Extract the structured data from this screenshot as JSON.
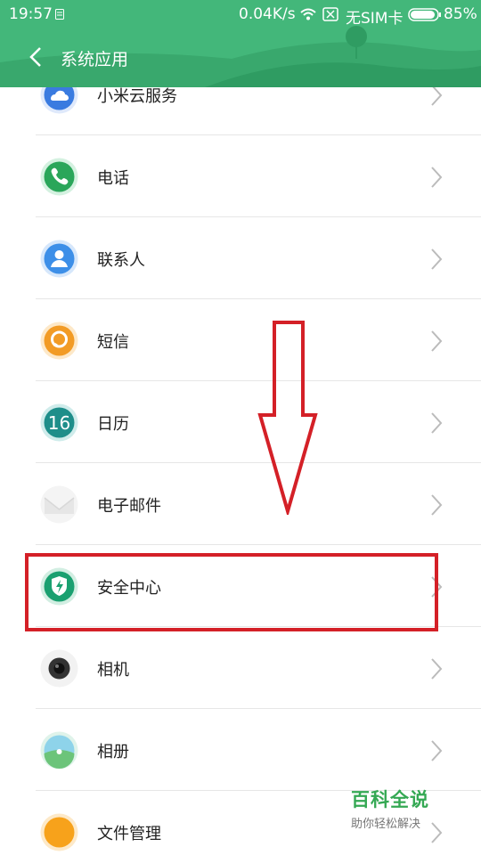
{
  "status_bar": {
    "time": "19:57",
    "speed": "0.04K/s",
    "sim": "无SIM卡",
    "battery": "85%"
  },
  "header": {
    "title": "系统应用"
  },
  "apps": [
    {
      "name": "小米云服务",
      "icon": "cloud-icon",
      "color": "#3a7be0"
    },
    {
      "name": "电话",
      "icon": "phone-icon",
      "color": "#2aa65a"
    },
    {
      "name": "联系人",
      "icon": "contacts-icon",
      "color": "#3d8fe8"
    },
    {
      "name": "短信",
      "icon": "message-icon",
      "color": "#f29b25"
    },
    {
      "name": "日历",
      "icon": "calendar-icon",
      "color": "#1e8e8a",
      "icon_text": "16"
    },
    {
      "name": "电子邮件",
      "icon": "mail-icon",
      "color": "#e8e8e8"
    },
    {
      "name": "安全中心",
      "icon": "security-shield-icon",
      "color": "#1aa070"
    },
    {
      "name": "相机",
      "icon": "camera-icon",
      "color": "#333333"
    },
    {
      "name": "相册",
      "icon": "gallery-icon",
      "color": "#68c7a3"
    },
    {
      "name": "文件管理",
      "icon": "file-manager-icon",
      "color": "#f7a21b"
    }
  ],
  "watermark": {
    "title": "百科全说",
    "subtitle": "助你轻松解决"
  }
}
